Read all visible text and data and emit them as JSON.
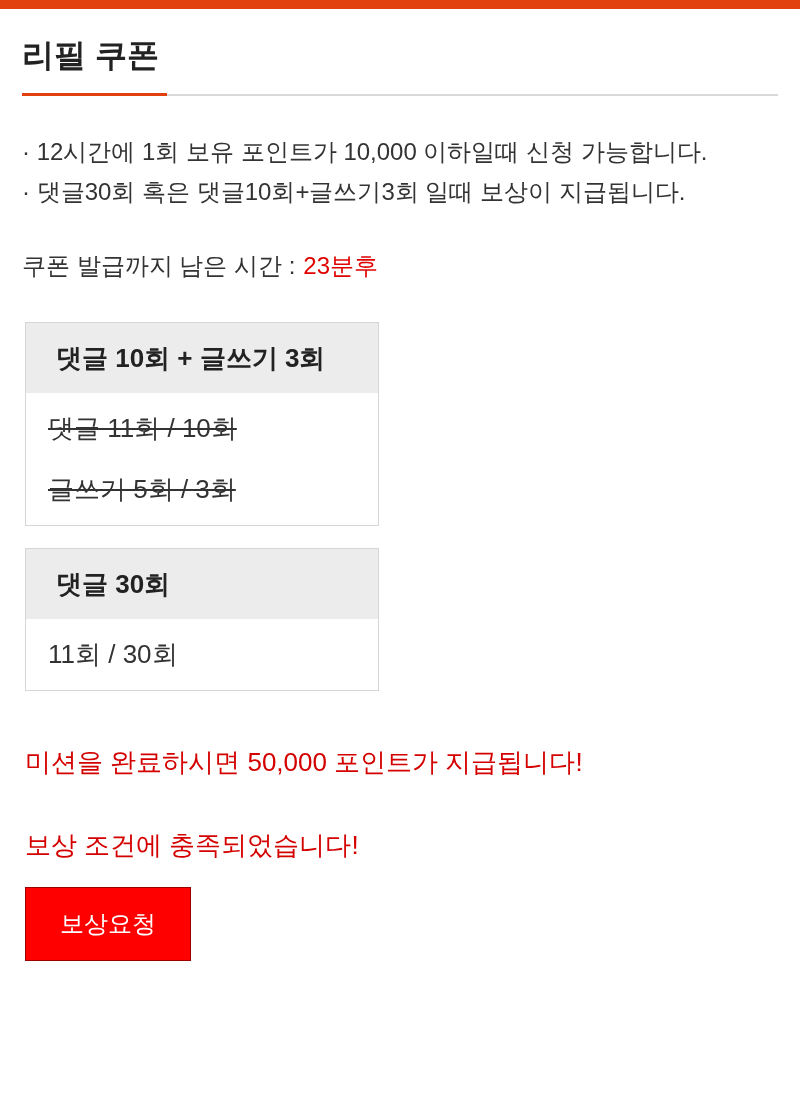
{
  "title": "리필 쿠폰",
  "notes": [
    "· 12시간에 1회 보유 포인트가 10,000 이하일때 신청 가능합니다.",
    "· 댓글30회 혹은 댓글10회+글쓰기3회 일때 보상이 지급됩니다."
  ],
  "timer": {
    "label": "쿠폰 발급까지 남은 시간 :",
    "value": "23분후"
  },
  "missions": [
    {
      "title": "댓글 10회 + 글쓰기 3회",
      "items": [
        {
          "text": "댓글 11회 / 10회",
          "completed": true
        },
        {
          "text": "글쓰기 5회 / 3회",
          "completed": true
        }
      ]
    },
    {
      "title": "댓글 30회",
      "items": [
        {
          "text": "11회 / 30회",
          "completed": false
        }
      ]
    }
  ],
  "messages": [
    "미션을 완료하시면 50,000 포인트가 지급됩니다!",
    "보상 조건에 충족되었습니다!"
  ],
  "button": "보상요청"
}
